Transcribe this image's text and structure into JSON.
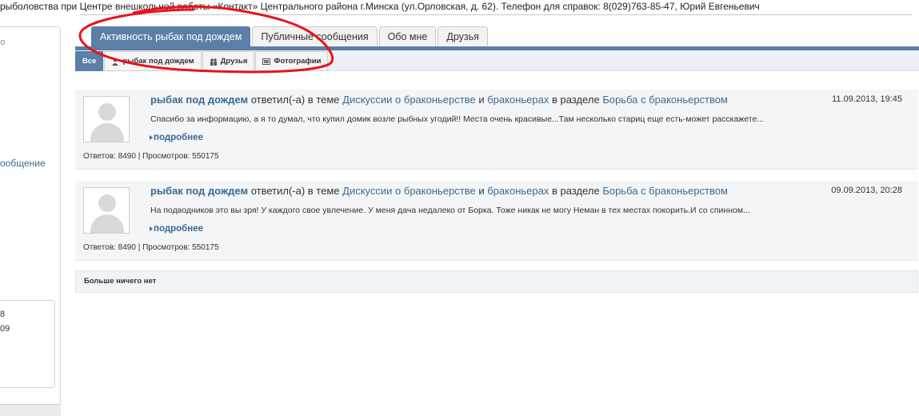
{
  "topline": "рыболовства при Центре внешкольной работы «Контакт» Центрального района г.Минска (ул.Орловская, д. 62). Телефон для справок: 8(029)763-85-47, Юрий Евгеньевич",
  "sidebar": {
    "dot": "o",
    "link": "ообщение",
    "num1": "8",
    "num2": "09"
  },
  "tabs": [
    {
      "label": "Активность рыбак под дождем",
      "active": true
    },
    {
      "label": "Публичные сообщения",
      "active": false
    },
    {
      "label": "Обо мне",
      "active": false
    },
    {
      "label": "Друзья",
      "active": false
    }
  ],
  "subtabs": [
    {
      "label": "Все",
      "icon": null,
      "active": true
    },
    {
      "label": "рыбак под дождем",
      "icon": "user-icon",
      "active": false
    },
    {
      "label": "Друзья",
      "icon": "friends-icon",
      "active": false
    },
    {
      "label": "Фотографии",
      "icon": "photo-icon",
      "active": false
    }
  ],
  "items": [
    {
      "user": "рыбак под дождем",
      "action1": "ответил(-а) в теме",
      "topic": "Дискуссии о браконьерстве",
      "conj": "и",
      "topic2": "браконьерах",
      "action2": "в разделе",
      "section": "Борьба с браконьерством",
      "date": "11.09.2013, 19:45",
      "text": "Спасибо за информацию, а я то думал, что купил домик возле рыбных угодий!! Места очень красивые...Там несколько стариц еще есть-может расскажете...",
      "more": "подробнее",
      "stats": "Ответов: 8490 | Просмотров: 550175"
    },
    {
      "user": "рыбак под дождем",
      "action1": "ответил(-а) в теме",
      "topic": "Дискуссии о браконьерстве",
      "conj": "и",
      "topic2": "браконьерах",
      "action2": "в разделе",
      "section": "Борьба с браконьерством",
      "date": "09.09.2013, 20:28",
      "text": "На подводников это вы зря! У каждого свое увлечение. У меня дача недалеко от Борка. Тоже никак не могу Неман в тех местах покорить.И со спинном...",
      "more": "подробнее",
      "stats": "Ответов: 8490 | Просмотров: 550175"
    }
  ],
  "nomore": "Больше ничего нет",
  "colors": {
    "accent": "#5b7fa6",
    "link": "#3b6a93",
    "annotation": "#e8141a"
  }
}
